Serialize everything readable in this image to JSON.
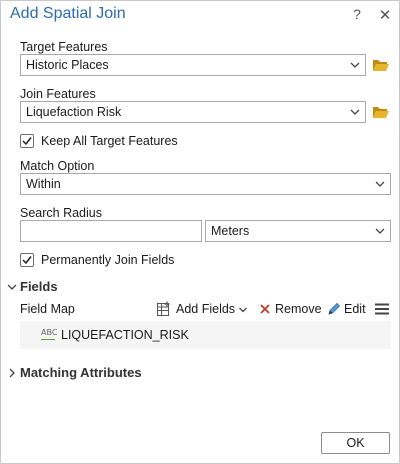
{
  "dialog": {
    "title": "Add Spatial Join",
    "help": "?",
    "close": "✕"
  },
  "target_features": {
    "label": "Target Features",
    "value": "Historic Places"
  },
  "join_features": {
    "label": "Join Features",
    "value": "Liquefaction Risk"
  },
  "keep_all": {
    "label": "Keep All Target Features",
    "checked": true
  },
  "match_option": {
    "label": "Match Option",
    "value": "Within"
  },
  "search_radius": {
    "label": "Search Radius",
    "value": "",
    "unit": "Meters"
  },
  "permanent_join": {
    "label": "Permanently Join Fields",
    "checked": true
  },
  "fields": {
    "heading": "Fields",
    "field_map_label": "Field Map",
    "add_fields": "Add Fields",
    "remove": "Remove",
    "edit": "Edit",
    "items": [
      {
        "type_glyph": "ABC",
        "name": "LIQUEFACTION_RISK"
      }
    ]
  },
  "matching_attributes": {
    "heading": "Matching Attributes"
  },
  "ok_label": "OK",
  "colors": {
    "title": "#2b6cb0",
    "folder": "#d9a21b",
    "remove": "#c0392b",
    "edit": "#2b6cb0"
  }
}
